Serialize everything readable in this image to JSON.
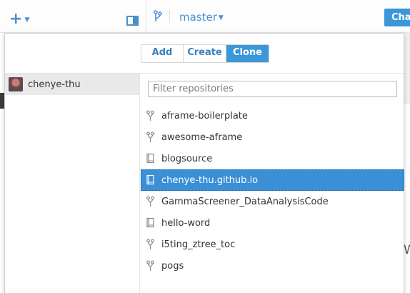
{
  "toolbar": {
    "branch": "master",
    "changes_button_label": "Changes",
    "add_menu_icon": "plus-icon"
  },
  "popover": {
    "tabs": [
      {
        "label": "Add",
        "active": false
      },
      {
        "label": "Create",
        "active": false
      },
      {
        "label": "Clone",
        "active": true
      }
    ],
    "accounts": [
      {
        "name": "chenye-thu",
        "selected": true
      }
    ],
    "filter": {
      "placeholder": "Filter repositories",
      "value": ""
    },
    "repositories": [
      {
        "name": "aframe-boilerplate",
        "icon": "fork-icon",
        "selected": false
      },
      {
        "name": "awesome-aframe",
        "icon": "fork-icon",
        "selected": false
      },
      {
        "name": "blogsource",
        "icon": "repo-icon",
        "selected": false
      },
      {
        "name": "chenye-thu.github.io",
        "icon": "repo-icon",
        "selected": true
      },
      {
        "name": "GammaScreener_DataAnalysisCode",
        "icon": "fork-icon",
        "selected": false
      },
      {
        "name": "hello-word",
        "icon": "repo-icon",
        "selected": false
      },
      {
        "name": "i5ting_ztree_toc",
        "icon": "fork-icon",
        "selected": false
      },
      {
        "name": "pogs",
        "icon": "fork-icon",
        "selected": false
      }
    ]
  },
  "colors": {
    "accent": "#3a97d8",
    "selection": "#3a8fd6",
    "link": "#4a8fd0"
  },
  "background": {
    "partial_text": "W"
  }
}
